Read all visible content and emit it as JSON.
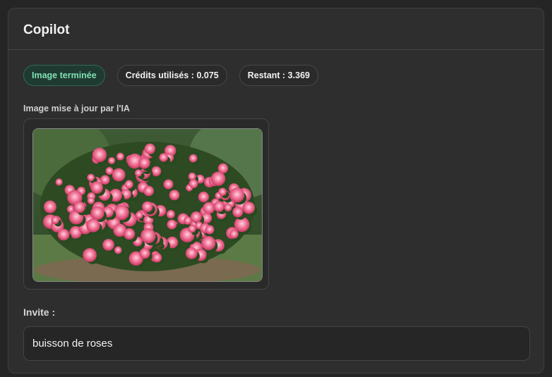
{
  "panel": {
    "title": "Copilot"
  },
  "badges": {
    "status": "Image terminée",
    "credits_used": "Crédits utilisés : 0.075",
    "remaining": "Restant : 3.369"
  },
  "image_section": {
    "label": "Image mise à jour par l'IA",
    "image_description_icon": "rose-bush-photo"
  },
  "prompt": {
    "label": "Invite :",
    "value": "buisson de roses"
  },
  "colors": {
    "panel_bg": "#2e2e2e",
    "status_badge_bg": "#1f3b31",
    "status_badge_text": "#7fe0b4"
  }
}
